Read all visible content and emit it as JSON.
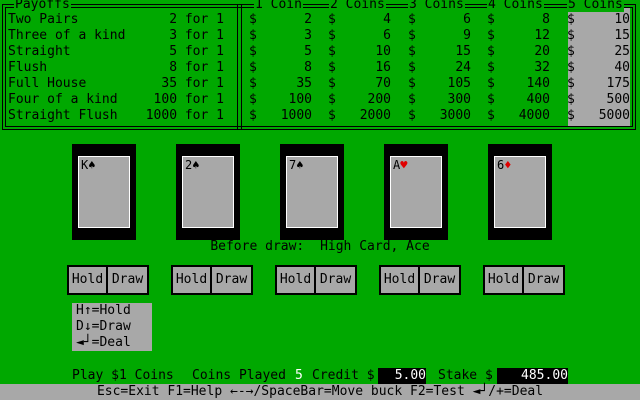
{
  "payoffs": {
    "legend": "Payoffs",
    "coin_headers": [
      "1 Coin",
      "2 Coins",
      "3 Coins",
      "4 Coins",
      "5 Coins"
    ],
    "currency": "$",
    "rows": [
      {
        "hand": "Two Pairs",
        "mult": "2 for 1",
        "values": [
          "2",
          "4",
          "6",
          "8",
          "10"
        ]
      },
      {
        "hand": "Three of a kind",
        "mult": "3 for 1",
        "values": [
          "3",
          "6",
          "9",
          "12",
          "15"
        ]
      },
      {
        "hand": "Straight",
        "mult": "5 for 1",
        "values": [
          "5",
          "10",
          "15",
          "20",
          "25"
        ]
      },
      {
        "hand": "Flush",
        "mult": "8 for 1",
        "values": [
          "8",
          "16",
          "24",
          "32",
          "40"
        ]
      },
      {
        "hand": "Full House",
        "mult": "35 for 1",
        "values": [
          "35",
          "70",
          "105",
          "140",
          "175"
        ]
      },
      {
        "hand": "Four of a kind",
        "mult": "100 for 1",
        "values": [
          "100",
          "200",
          "300",
          "400",
          "500"
        ]
      },
      {
        "hand": "Straight Flush",
        "mult": "1000 for 1",
        "values": [
          "1000",
          "2000",
          "3000",
          "4000",
          "5000"
        ]
      }
    ]
  },
  "cards": [
    {
      "rank": "K",
      "suit": "♠",
      "color": "black"
    },
    {
      "rank": "2",
      "suit": "♠",
      "color": "black"
    },
    {
      "rank": "7",
      "suit": "♠",
      "color": "black"
    },
    {
      "rank": "A",
      "suit": "♥",
      "color": "red"
    },
    {
      "rank": "6",
      "suit": "♦",
      "color": "red"
    }
  ],
  "status": {
    "label": "Before draw:",
    "result": "High Card, Ace"
  },
  "buttons": {
    "hold": "Hold",
    "draw": "Draw"
  },
  "help": {
    "lines": [
      "H↑=Hold",
      "D↓=Draw",
      "◄┘=Deal"
    ]
  },
  "info": {
    "play": "Play $1 Coins",
    "coins_played_label": "Coins Played",
    "coins_played": "5",
    "credit_label": "Credit $",
    "credit": "5.00",
    "stake_label": "Stake $",
    "stake": "485.00"
  },
  "footer": "Esc=Exit F1=Help ←-→/SpaceBar=Move buck F2=Test ◄┘/+=Deal",
  "colors": {
    "felt": "#00a800",
    "panel": "#a8a8a8",
    "red_suit": "#e00000"
  }
}
